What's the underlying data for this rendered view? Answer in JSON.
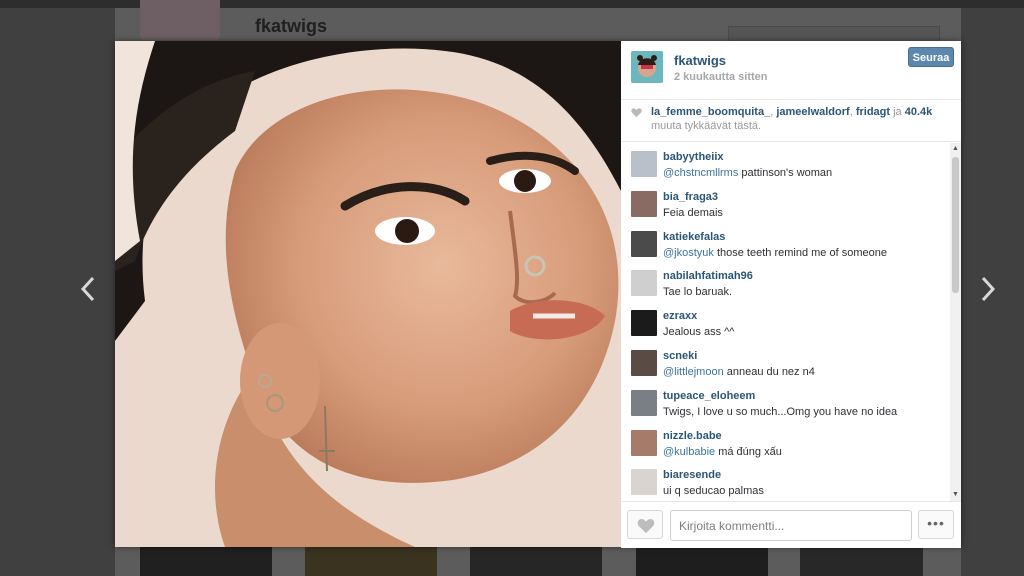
{
  "background": {
    "profile_username": "fkatwigs"
  },
  "post": {
    "username": "fkatwigs",
    "time_ago": "2 kuukautta sitten",
    "follow_label": "Seuraa",
    "likes": {
      "users": [
        "la_femme_boomquita_",
        "jameelwaldorf",
        "fridagt"
      ],
      "connector": "ja",
      "others_count": "40.4k",
      "suffix": "muuta tykkäävät tästä."
    }
  },
  "comments": [
    {
      "user": "babyytheiix",
      "mention": "@chstncmllrms",
      "text": "pattinson's woman",
      "avatar_color": "#b9c0c9"
    },
    {
      "user": "bia_fraga3",
      "mention": "",
      "text": "Feia demais",
      "avatar_color": "#8a6b64"
    },
    {
      "user": "katiekefalas",
      "mention": "@jkostyuk",
      "text": "those teeth remind me of someone",
      "avatar_color": "#4b4b4b"
    },
    {
      "user": "nabilahfatimah96",
      "mention": "",
      "text": "Tae lo baruak.",
      "avatar_color": "#cfcfcf"
    },
    {
      "user": "ezraxx",
      "mention": "",
      "text": "Jealous ass ^^",
      "avatar_color": "#1b1b1b"
    },
    {
      "user": "scneki",
      "mention": "@littlejmoon",
      "text": "anneau du nez n4",
      "avatar_color": "#5a4b45"
    },
    {
      "user": "tupeace_eloheem",
      "mention": "",
      "text": "Twigs, I love u so much...Omg you have no idea",
      "avatar_color": "#7a7f86"
    },
    {
      "user": "nizzle.babe",
      "mention": "@kulbabie",
      "text": "má đúng xấu",
      "avatar_color": "#a67b6a"
    },
    {
      "user": "biaresende",
      "mention": "",
      "text": "ui q seducao palmas",
      "avatar_color": "#d9d4cf"
    }
  ],
  "comment_input": {
    "placeholder": "Kirjoita kommentti..."
  },
  "more_label": "•••",
  "icons": {
    "prev": "chevron-left-icon",
    "next": "chevron-right-icon",
    "like": "heart-icon",
    "more": "ellipsis-icon"
  },
  "colors": {
    "link_blue": "#2b5576",
    "follow_button": "#5d88ad",
    "muted_text": "#a5a7aa"
  }
}
